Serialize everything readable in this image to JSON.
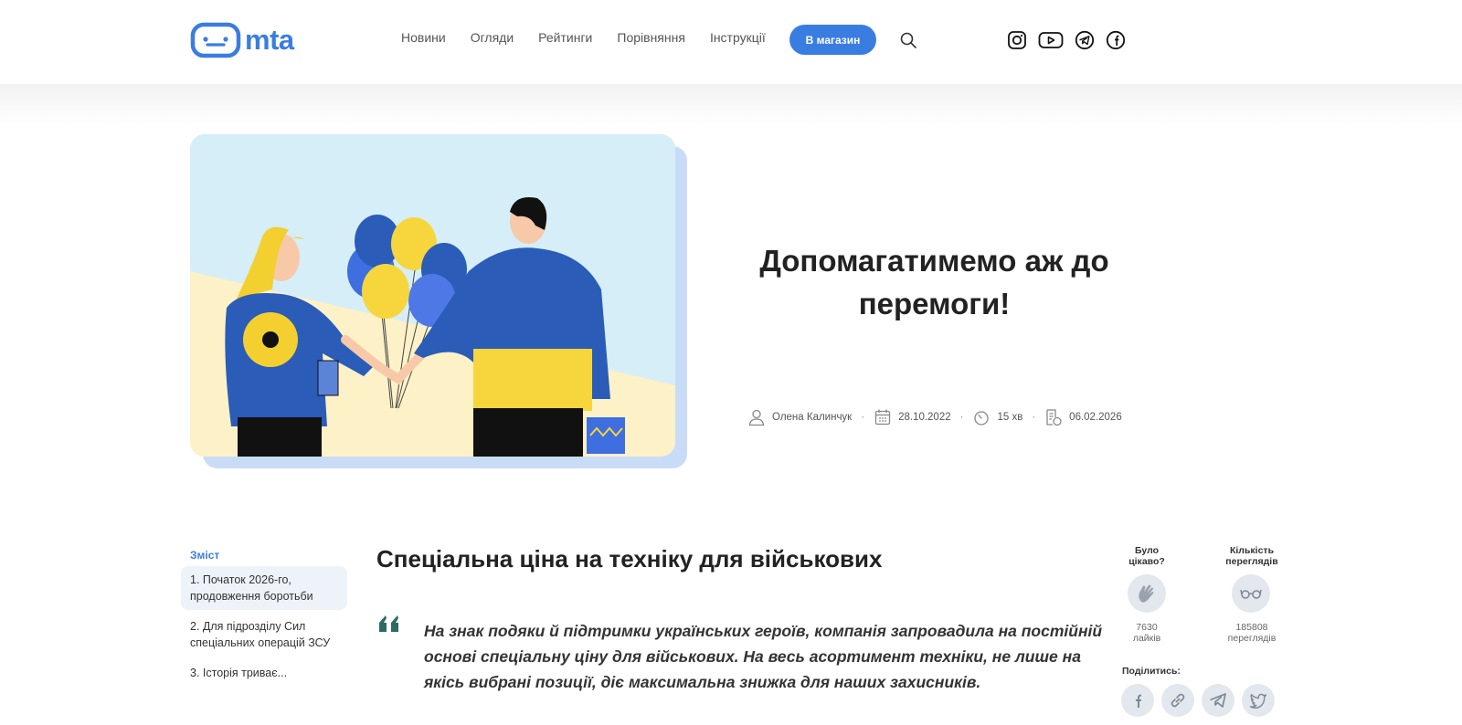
{
  "header": {
    "logo_text": "mta",
    "nav": [
      "Новини",
      "Огляди",
      "Рейтинги",
      "Порівняння",
      "Інструкції"
    ],
    "shop_button": "В магазин",
    "social_icons": [
      "instagram-icon",
      "youtube-icon",
      "telegram-icon",
      "facebook-icon"
    ]
  },
  "article": {
    "title": "Допомагатимемо аж до перемоги!",
    "author": "Олена Калинчук",
    "published": "28.10.2022",
    "read_time": "15 хв",
    "updated": "06.02.2026",
    "section_heading": "Спеціальна ціна на техніку для військових",
    "quote": "На знак подяки й підтримки українських героїв, компанія запровадила на постійній основі спеціальну ціну для військових. На весь асортимент техніки, не лише на якісь вибрані позиції, діє максимальна знижка для наших захисників."
  },
  "toc": {
    "title": "Зміст",
    "items": [
      "1. Початок 2026-го, продовження боротьби",
      "2. Для підрозділу Сил спеціальних операцій ЗСУ",
      "3. Історія триває..."
    ]
  },
  "stats": {
    "likes_label": "Було цікаво?",
    "likes_value": "7630",
    "likes_unit": "лайків",
    "views_label": "Кількість переглядів",
    "views_value": "185808",
    "views_unit": "переглядів",
    "share_label": "Поділитись:"
  },
  "colors": {
    "accent": "#3a7de0",
    "blue": "#2b5cb8",
    "yellow": "#f6d63c"
  }
}
